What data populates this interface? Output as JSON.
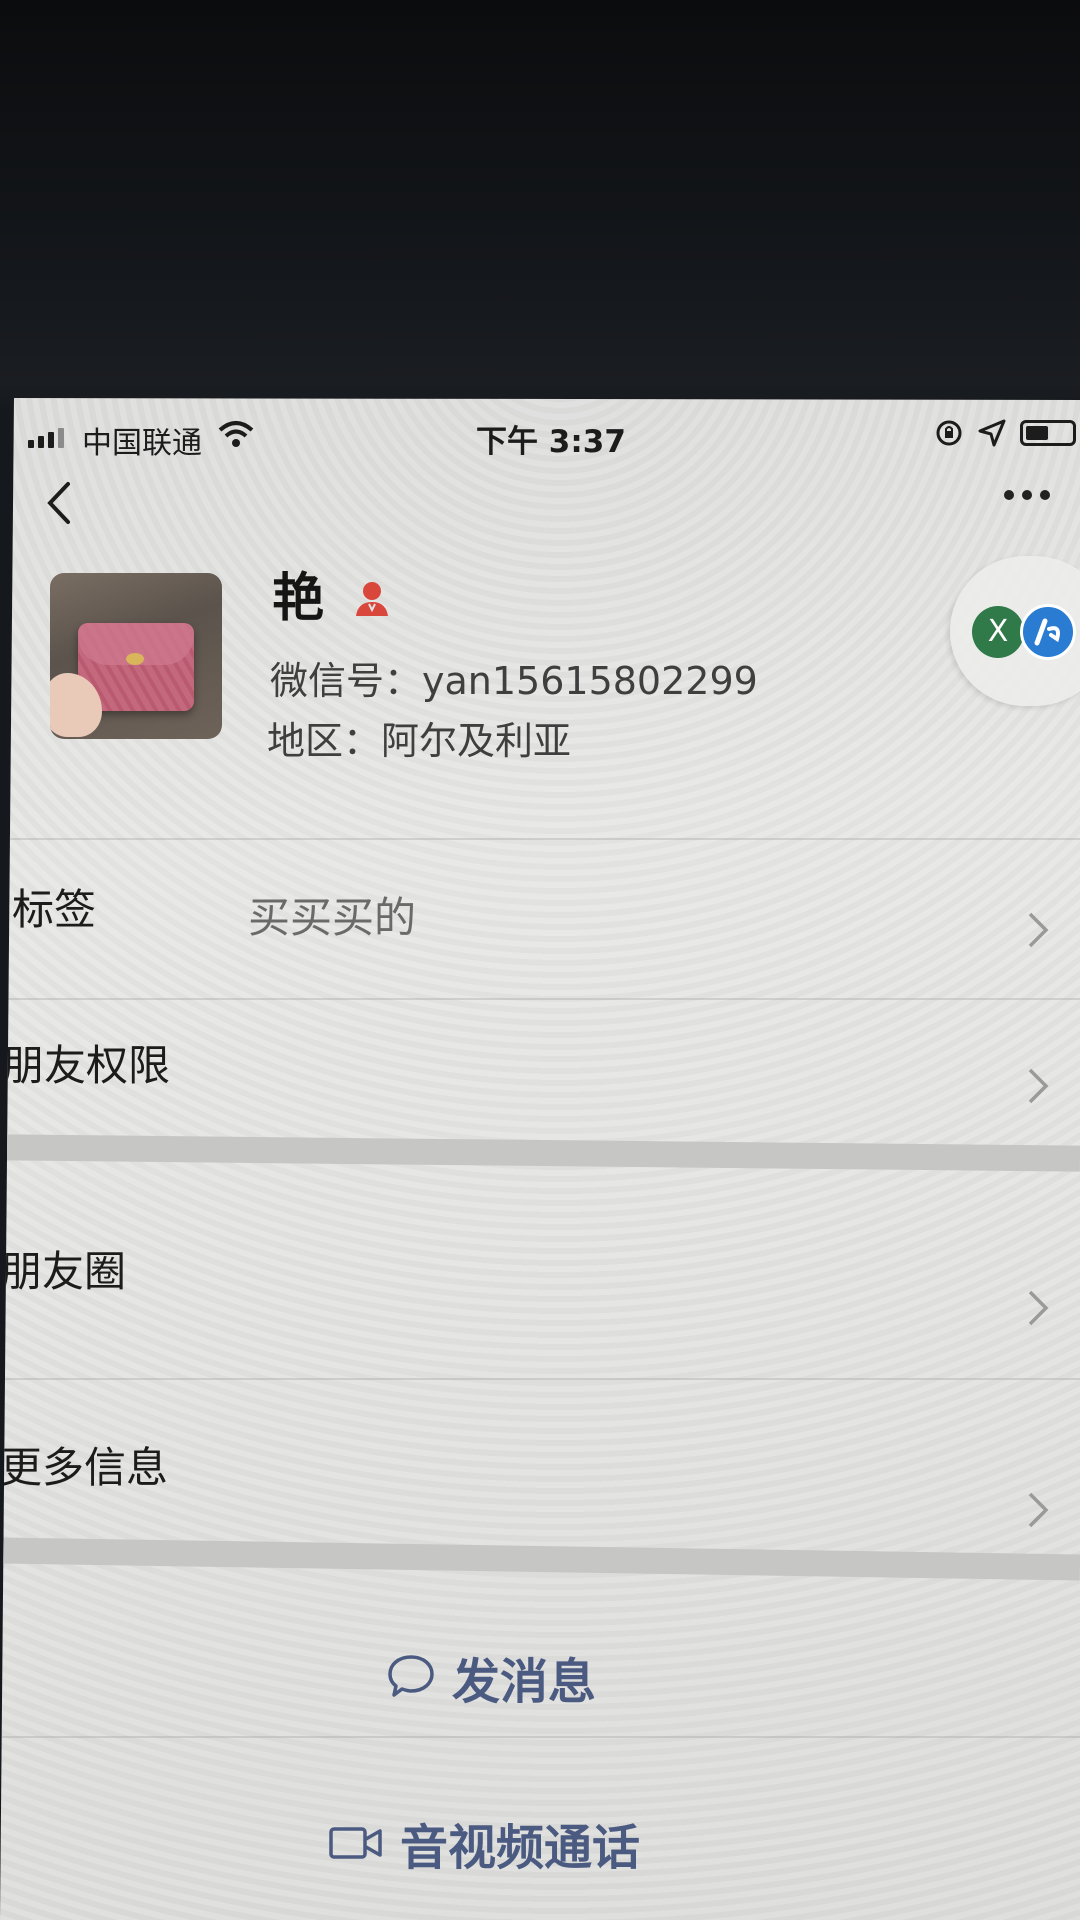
{
  "status_bar": {
    "carrier": "中国联通",
    "time": "下午 3:37"
  },
  "profile": {
    "nickname": "艳",
    "wechat_id": "微信号：yan15615802299",
    "region": "地区：阿尔及利亚",
    "gender": "female"
  },
  "side_badge": {
    "letter": "X"
  },
  "rows": {
    "tags": {
      "label": "标签",
      "value": "买买买的"
    },
    "permissions": {
      "label": "朋友权限"
    },
    "moments": {
      "label": "朋友圈"
    },
    "more_info": {
      "label": "更多信息"
    }
  },
  "actions": {
    "send_message": "发消息",
    "av_call": "音视频通话"
  },
  "colors": {
    "action_text": "#4a5a80",
    "gender_icon": "#d9463b",
    "screen_bg": "#e4e4e2"
  }
}
